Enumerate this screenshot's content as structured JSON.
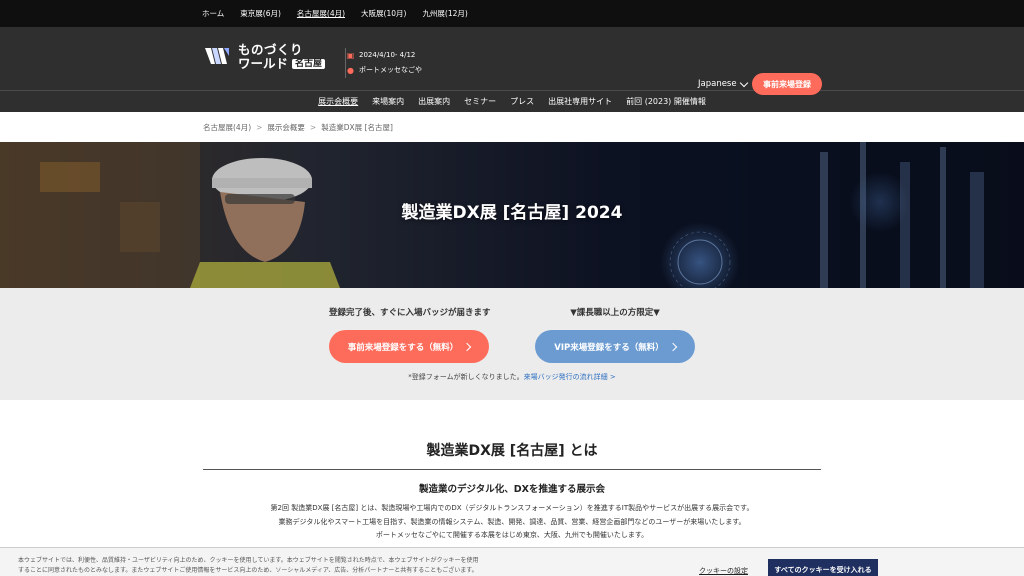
{
  "topnav": {
    "items": [
      {
        "label": "ホーム"
      },
      {
        "label": "東京展(6月)"
      },
      {
        "label": "名古屋展(4月)"
      },
      {
        "label": "大阪展(10月)"
      },
      {
        "label": "九州展(12月)"
      }
    ]
  },
  "header": {
    "logo_line1": "ものづくり",
    "logo_line2": "ワールド",
    "logo_badge": "名古屋",
    "dates": "2024/4/10- 4/12",
    "venue": "ポートメッセなごや",
    "language": "Japanese",
    "cta": "事前来場登録"
  },
  "gnav": {
    "items": [
      {
        "label": "展示会概要"
      },
      {
        "label": "来場案内"
      },
      {
        "label": "出展案内"
      },
      {
        "label": "セミナー"
      },
      {
        "label": "プレス"
      },
      {
        "label": "出展社専用サイト"
      },
      {
        "label": "前回 (2023) 開催情報"
      }
    ]
  },
  "breadcrumb": {
    "items": [
      "名古屋展(4月)",
      "展示会概要",
      "製造業DX展 [名古屋]"
    ],
    "separator": ">"
  },
  "hero": {
    "title": "製造業DX展 [名古屋] 2024"
  },
  "registration": {
    "left_caption": "登録完了後、すぐに入場バッジが届きます",
    "left_button": "事前来場登録をする（無料）",
    "right_caption": "▼課長職以上の方限定▼",
    "right_button": "VIP来場登録をする（無料）",
    "note_prefix": "*登録フォームが新しくなりました。",
    "note_link": "来場バッジ発行の流れ詳細 >"
  },
  "about": {
    "title": "製造業DX展 [名古屋] とは",
    "subtitle": "製造業のデジタル化、DXを推進する展示会",
    "lines": [
      "第2回 製造業DX展 [名古屋] とは、製造現場や工場内でのDX（デジタルトランスフォーメーション）を推進するIT製品やサービスが出展する展示会です。",
      "業務デジタル化やスマート工場を目指す、製造業の情報システム、製造、開発、調達、品質、営業、経営企画部門などのユーザーが来場いたします。",
      "ポートメッセなごやにて開催する本展をはじめ東京、大阪、九州でも開催いたします。"
    ]
  },
  "cookie": {
    "line1": "本ウェブサイトでは、利便性、品質維持・ユーザビリティ向上のため、クッキーを使用しています。本ウェブサイトを閲覧された時点で、本ウェブサイトがクッキーを使用",
    "line2": "することに同意されたものとみなします。またウェブサイトご使用情報をサービス向上のため、ソーシャルメディア、広告、分析パートナーと共有することもございます。",
    "settings": "クッキーの設定",
    "accept": "すべてのクッキーを受け入れる"
  },
  "colors": {
    "accent_orange": "#fd6c5b",
    "accent_blue": "#6b9bd1",
    "header_bg": "#2f2f2f",
    "topbar_bg": "#0f0f0f",
    "cookie_button": "#1f2f5f"
  }
}
